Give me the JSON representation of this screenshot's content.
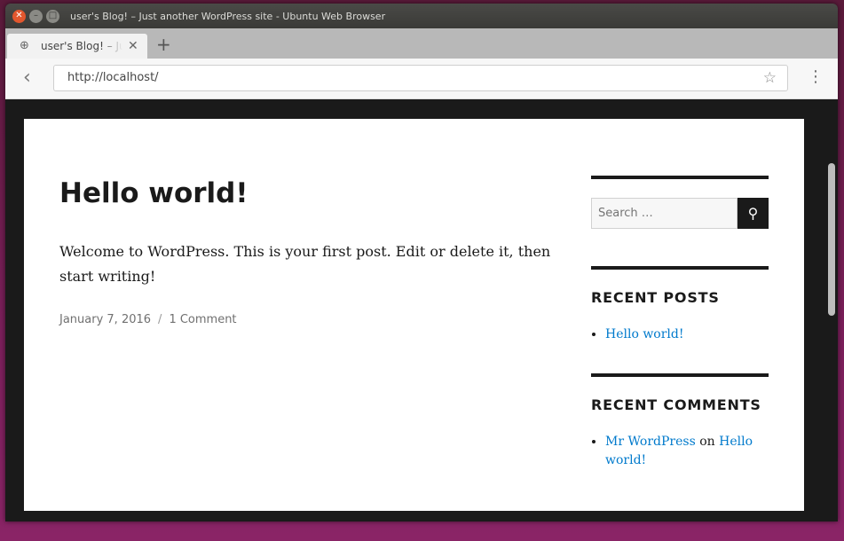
{
  "window": {
    "title": "user's Blog! – Just another WordPress site - Ubuntu Web Browser"
  },
  "tab": {
    "title": "user's Blog! – Just another WordPress site"
  },
  "address": {
    "url": "http://localhost/"
  },
  "post": {
    "title": "Hello world!",
    "content": "Welcome to WordPress. This is your first post. Edit or delete it, then start writing!",
    "date": "January 7, 2016",
    "separator": "/",
    "comments": "1 Comment"
  },
  "sidebar": {
    "search_placeholder": "Search …",
    "recent_posts_title": "RECENT POSTS",
    "recent_posts": [
      "Hello world!"
    ],
    "recent_comments_title": "RECENT COMMENTS",
    "recent_comment": {
      "author": "Mr WordPress",
      "on": "on",
      "post": "Hello world!"
    }
  },
  "icons": {
    "close": "close-icon",
    "minimize": "minimize-icon",
    "maximize": "maximize-icon",
    "globe": "globe-icon",
    "tab_close": "close-icon",
    "new_tab": "plus-icon",
    "back": "chevron-left-icon",
    "bookmark": "star-icon",
    "menu": "menu-icon",
    "search": "search-icon"
  },
  "colors": {
    "link": "#007acc",
    "close_button": "#e2572e",
    "page_frame": "#1a1a1a"
  }
}
